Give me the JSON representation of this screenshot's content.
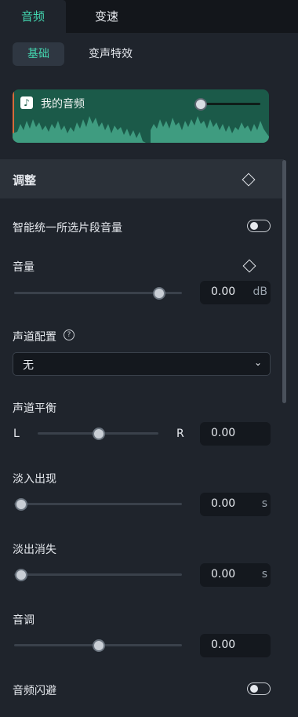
{
  "tabs": [
    "音频",
    "变速"
  ],
  "subtabs": [
    "基础",
    "变声特效"
  ],
  "clip": {
    "name": "我的音频",
    "icon": "music-note-icon",
    "volume_level": 0
  },
  "section": {
    "title": "调整"
  },
  "normalize": {
    "label": "智能统一所选片段音量",
    "enabled": false
  },
  "volume": {
    "label": "音量",
    "value": "0.00",
    "unit": "dB",
    "slider_fraction": 0.86
  },
  "channel": {
    "label": "声道配置",
    "help": "?",
    "selected": "无"
  },
  "balance": {
    "label": "声道平衡",
    "left": "L",
    "right": "R",
    "value": "0.00",
    "slider_fraction": 0.5
  },
  "fade_in": {
    "label": "淡入出现",
    "value": "0.00",
    "unit": "s",
    "slider_fraction": 0
  },
  "fade_out": {
    "label": "淡出消失",
    "value": "0.00",
    "unit": "s",
    "slider_fraction": 0
  },
  "pitch": {
    "label": "音调",
    "value": "0.00",
    "slider_fraction": 0.5
  },
  "ducking": {
    "label": "音频闪避",
    "enabled": false
  },
  "colors": {
    "accent": "#43d6b0",
    "clip_bg": "#1b5a49",
    "panel_bg": "#1f242c"
  }
}
